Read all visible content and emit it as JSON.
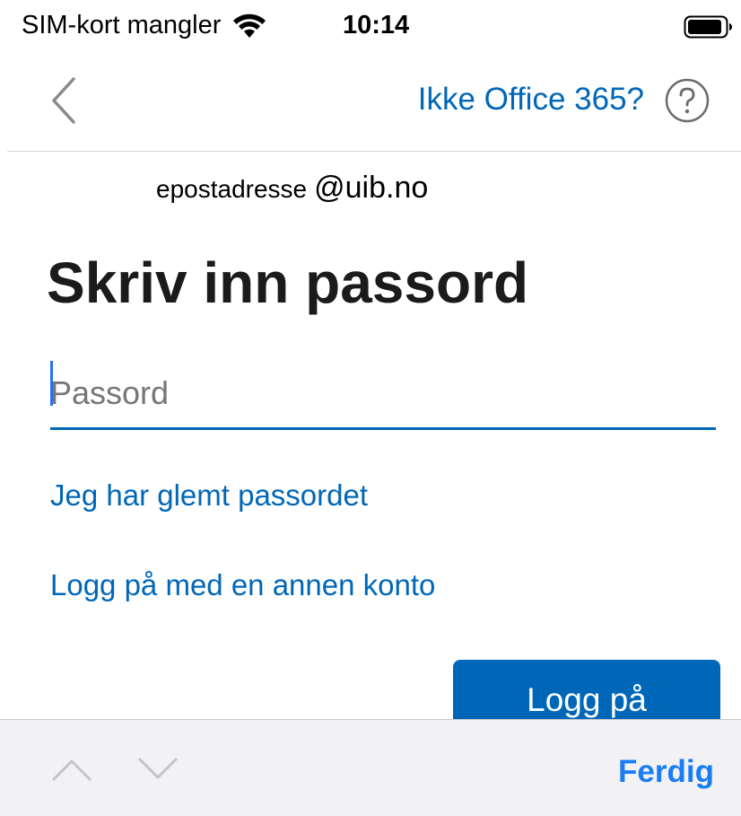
{
  "status_bar": {
    "carrier": "SIM-kort mangler",
    "time": "10:14"
  },
  "nav": {
    "back_icon": "chevron-left-icon",
    "not_office_link": "Ikke Office 365?",
    "help_icon": "question-circle-icon"
  },
  "account": {
    "email_user": "epostadresse",
    "email_domain": "@uib.no"
  },
  "page": {
    "title": "Skriv inn passord"
  },
  "password": {
    "placeholder": "Passord",
    "value": ""
  },
  "links": {
    "forgot_password": "Jeg har glemt passordet",
    "other_account": "Logg på med en annen konto"
  },
  "signin_button": "Logg på",
  "keyboard_bar": {
    "prev_icon": "chevron-up-icon",
    "next_icon": "chevron-down-icon",
    "done": "Ferdig"
  },
  "colors": {
    "accent": "#0067b8",
    "ios_blue": "#1a7df4",
    "caret": "#2b6ff7",
    "accessory_bar_bg": "#f2f2f4"
  }
}
